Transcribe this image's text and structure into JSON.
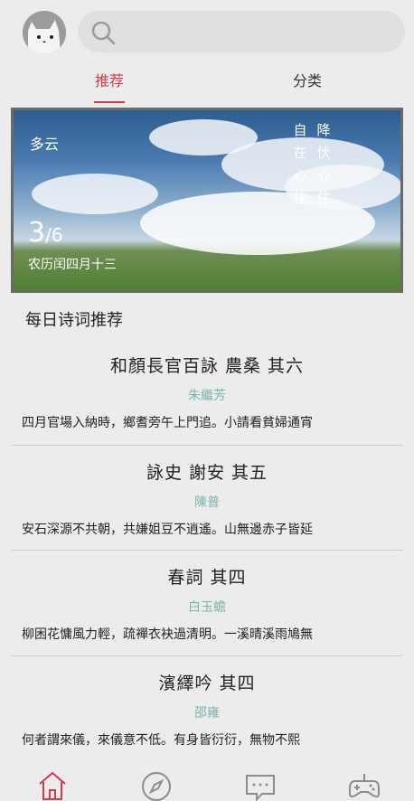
{
  "search": {
    "placeholder": ""
  },
  "tabs": [
    {
      "label": "推荐",
      "active": true
    },
    {
      "label": "分类",
      "active": false
    }
  ],
  "banner": {
    "weather": "多云",
    "verse_columns": [
      [
        "降",
        "伏",
        "心",
        "住"
      ],
      [
        "自",
        "在",
        "心",
        "住"
      ]
    ],
    "date_day": "3",
    "date_month": "/6",
    "lunar": "农历闰四月十三"
  },
  "section_title": "每日诗词推荐",
  "poems": [
    {
      "title": "和顏長官百詠 農桑 其六",
      "author": "朱繼芳",
      "snippet": "四月官場入納時，鄉耆旁午上門追。小請看貧婦通宵"
    },
    {
      "title": "詠史 謝安 其五",
      "author": "陳普",
      "snippet": "安石深源不共朝，共嫌姐豆不逍遙。山無邊赤子皆延"
    },
    {
      "title": "春詞 其四",
      "author": "白玉蟾",
      "snippet": "柳困花慵風力輕，疏襌衣袂過清明。一溪晴溪雨鳩無"
    },
    {
      "title": "濱繹吟 其四",
      "author": "邵雍",
      "snippet": "何者謂來儀，來儀意不低。有身皆衍衍，無物不熙"
    }
  ],
  "colors": {
    "accent": "#d23b4d",
    "author": "#7db3ad",
    "background": "#ececec"
  },
  "bottom_nav": [
    {
      "icon": "home-icon",
      "active": true
    },
    {
      "icon": "compass-icon",
      "active": false
    },
    {
      "icon": "message-icon",
      "active": false
    },
    {
      "icon": "gamepad-icon",
      "active": false
    }
  ]
}
